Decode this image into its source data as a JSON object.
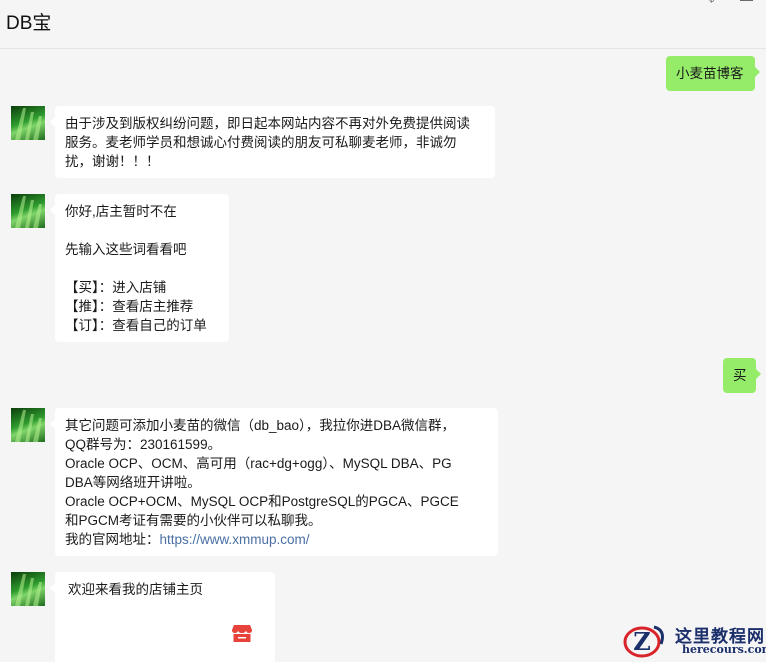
{
  "window": {
    "title": "DB宝",
    "pin_glyph": "⌖",
    "minimize_glyph": "—"
  },
  "messages": [
    {
      "side": "right",
      "lines": [
        "小麦苗博客"
      ]
    },
    {
      "side": "left",
      "lines": [
        "由于涉及到版权纠纷问题，即日起本网站内容不再对外免费提供阅读",
        "服务。麦老师学员和想诚心付费阅读的朋友可私聊麦老师，非诚勿",
        "扰，谢谢！！！"
      ]
    },
    {
      "side": "left",
      "lines": [
        "你好,店主暂时不在",
        "",
        "先输入这些词看看吧",
        "",
        "【买】：进入店铺",
        "【推】：查看店主推荐",
        "【订】：查看自己的订单"
      ]
    },
    {
      "side": "right",
      "lines": [
        "买"
      ]
    },
    {
      "side": "left",
      "lines": [
        "其它问题可添加小麦苗的微信（db_bao），我拉你进DBA微信群，",
        "QQ群号为：230161599。",
        "Oracle OCP、OCM、高可用（rac+dg+ogg）、MySQL DBA、PG",
        "DBA等网络班开讲啦。",
        "Oracle OCP+OCM、MySQL OCP和PostgreSQL的PGCA、PGCE",
        "和PGCM考证有需要的小伙伴可以私聊我。"
      ],
      "site_label": "我的官网地址：",
      "site_url": "https://www.xmmup.com/"
    },
    {
      "side": "left",
      "lines": [
        "欢迎来看我的店铺主页"
      ],
      "icon": "shop-icon"
    }
  ],
  "watermark": {
    "title": "这里教程网",
    "url": "herecours.com",
    "logo_letter": "Z"
  },
  "colors": {
    "background": "#f5f5f5",
    "bubble_in": "#ffffff",
    "bubble_out": "#95ec69",
    "link": "#4a6fa5",
    "shop_icon": "#e8433a"
  }
}
